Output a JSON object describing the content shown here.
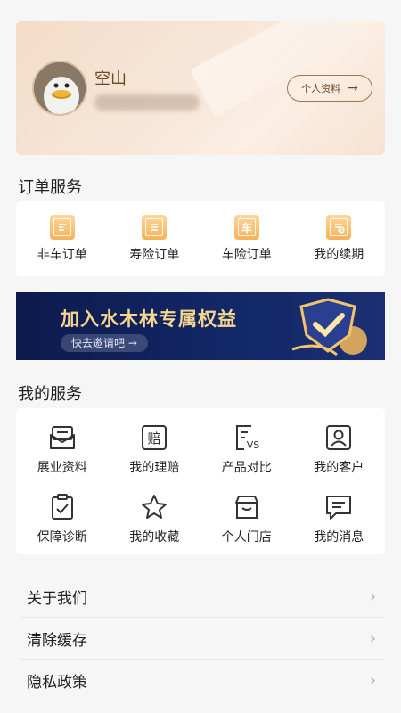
{
  "profile": {
    "name": "空山",
    "button_label": "个人资料",
    "button_arrow": "→"
  },
  "orders": {
    "title": "订单服务",
    "items": [
      {
        "label": "非车订单",
        "icon": "order-doc-icon"
      },
      {
        "label": "寿险订单",
        "icon": "life-order-icon"
      },
      {
        "label": "车险订单",
        "icon": "car-order-icon",
        "glyph": "车"
      },
      {
        "label": "我的续期",
        "icon": "renewal-icon"
      }
    ]
  },
  "banner": {
    "title": "加入水木林专属权益",
    "subtitle": "快去邀请吧 →"
  },
  "services": {
    "title": "我的服务",
    "items": [
      {
        "label": "展业资料",
        "icon": "envelope-icon"
      },
      {
        "label": "我的理赔",
        "icon": "claim-icon",
        "glyph": "赔"
      },
      {
        "label": "产品对比",
        "icon": "compare-icon",
        "glyph": "VS"
      },
      {
        "label": "我的客户",
        "icon": "customer-icon"
      },
      {
        "label": "保障诊断",
        "icon": "diagnosis-icon"
      },
      {
        "label": "我的收藏",
        "icon": "star-icon"
      },
      {
        "label": "个人门店",
        "icon": "store-icon"
      },
      {
        "label": "我的消息",
        "icon": "message-icon"
      }
    ]
  },
  "list": [
    {
      "label": "关于我们"
    },
    {
      "label": "清除缓存"
    },
    {
      "label": "隐私政策"
    }
  ],
  "colors": {
    "accent_orange": "#f6b25a",
    "banner_bg": "#122766",
    "banner_gold": "#f7d68e",
    "profile_text": "#6b4a2a"
  }
}
